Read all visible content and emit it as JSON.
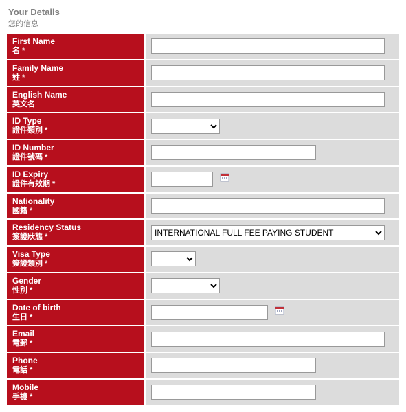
{
  "section": {
    "title_en": "Your Details",
    "title_zh": "您的信息"
  },
  "fields": {
    "firstName": {
      "en": "First Name",
      "zh": "名 *"
    },
    "familyName": {
      "en": "Family Name",
      "zh": "姓 *"
    },
    "englishName": {
      "en": "English Name",
      "zh": "英文名"
    },
    "idType": {
      "en": "ID Type",
      "zh": "證件類別 *"
    },
    "idNumber": {
      "en": "ID Number",
      "zh": "證件號碼 *"
    },
    "idExpiry": {
      "en": "ID Expiry",
      "zh": "證件有效期 *"
    },
    "nationality": {
      "en": "Nationality",
      "zh": "國籍 *"
    },
    "residencyStatus": {
      "en": "Residency Status",
      "zh": "簽證狀態 *",
      "selected": "INTERNATIONAL FULL FEE PAYING STUDENT"
    },
    "visaType": {
      "en": "Visa Type",
      "zh": "簽證類別 *"
    },
    "gender": {
      "en": "Gender",
      "zh": "性別 *"
    },
    "dob": {
      "en": "Date of birth",
      "zh": "生日 *"
    },
    "email": {
      "en": "Email",
      "zh": "電郵 *"
    },
    "phone": {
      "en": "Phone",
      "zh": "電話 *"
    },
    "mobile": {
      "en": "Mobile",
      "zh": "手機 *"
    }
  }
}
